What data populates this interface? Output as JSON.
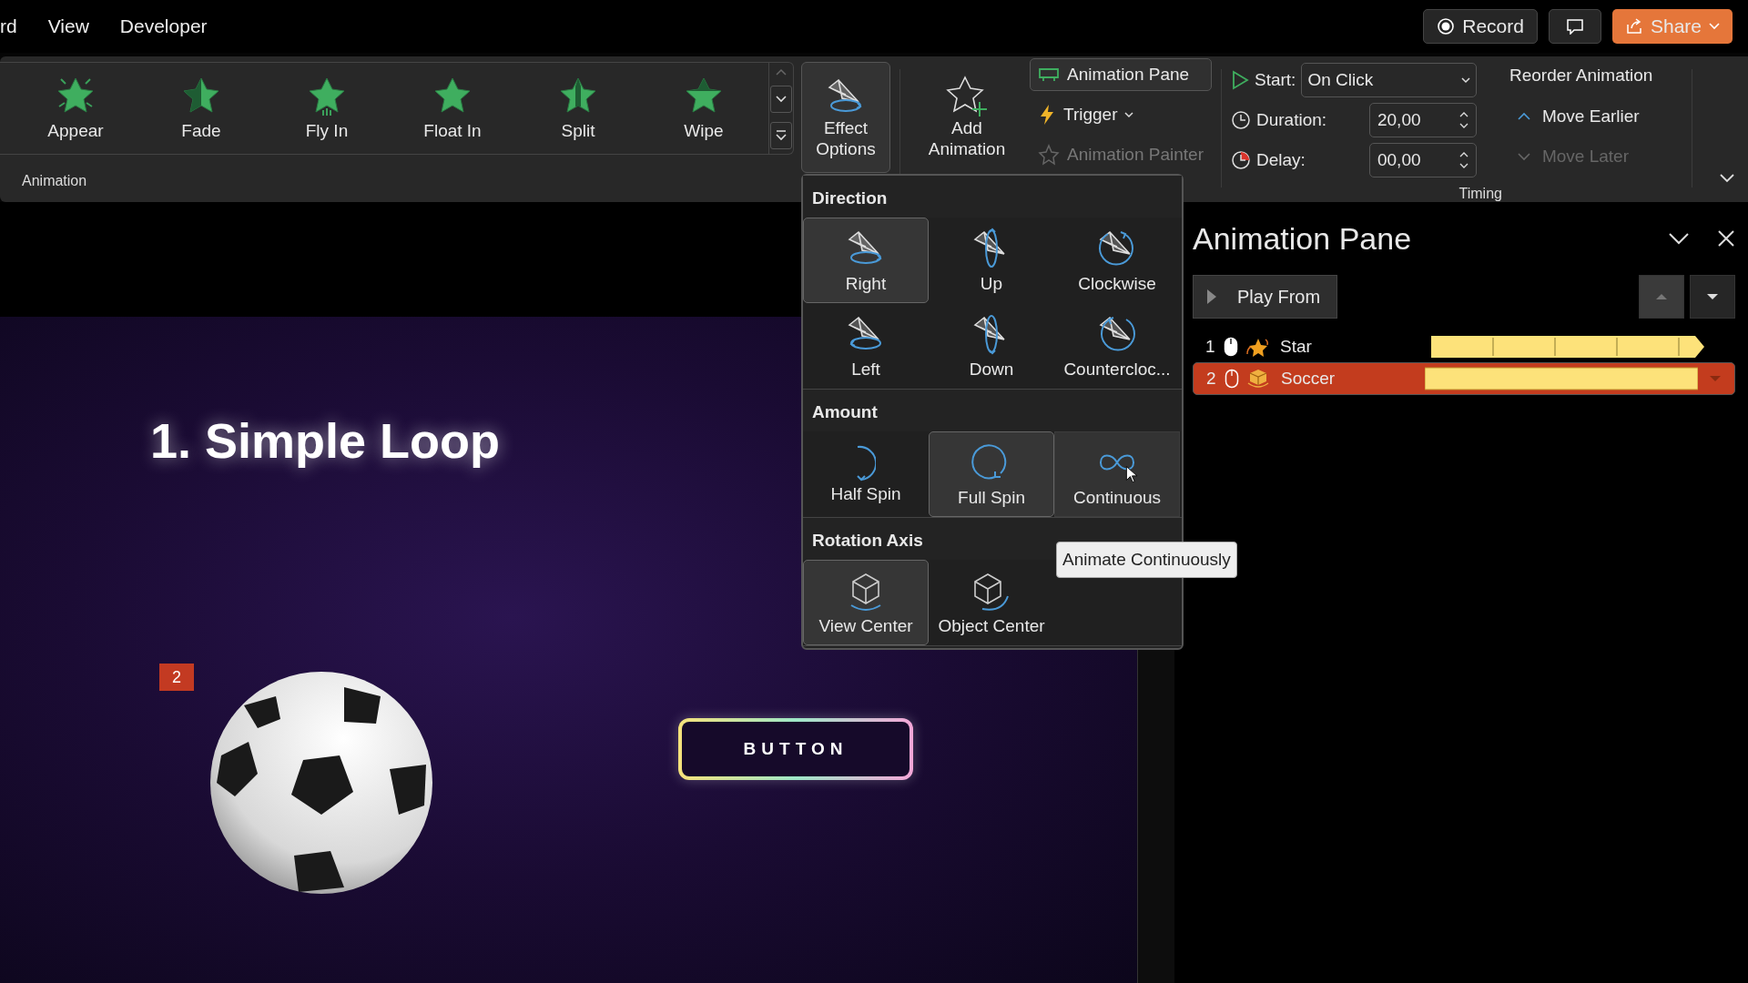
{
  "menu_tabs": [
    {
      "label": "rd"
    },
    {
      "label": "View"
    },
    {
      "label": "Developer"
    }
  ],
  "title_actions": {
    "record": "Record",
    "share": "Share"
  },
  "ribbon": {
    "gallery": {
      "items": [
        {
          "label": "Appear",
          "kind": "burst"
        },
        {
          "label": "Fade",
          "kind": "half"
        },
        {
          "label": "Fly In",
          "kind": "lines"
        },
        {
          "label": "Float In",
          "kind": "plain"
        },
        {
          "label": "Split",
          "kind": "split"
        },
        {
          "label": "Wipe",
          "kind": "wipe"
        }
      ],
      "group_label": "Animation"
    },
    "effect_options": "Effect Options",
    "add_animation": "Add Animation",
    "advanced": [
      {
        "label": "Animation Pane",
        "kind": "pane",
        "disabled": false
      },
      {
        "label": "Trigger",
        "kind": "trigger",
        "disabled": false
      },
      {
        "label": "Animation Painter",
        "kind": "painter",
        "disabled": true
      }
    ],
    "timing": {
      "start": {
        "label": "Start:",
        "value": "On Click"
      },
      "duration": {
        "label": "Duration:",
        "value": "20,00"
      },
      "delay": {
        "label": "Delay:",
        "value": "00,00"
      },
      "group_label": "Timing"
    },
    "reorder": {
      "title": "Reorder Animation",
      "items": [
        {
          "label": "Move Earlier",
          "kind": "up",
          "disabled": false
        },
        {
          "label": "Move Later",
          "kind": "down",
          "disabled": true
        }
      ]
    }
  },
  "effect_menu": {
    "sections": [
      {
        "title": "Direction",
        "options": [
          {
            "label": "Right",
            "kind": "right",
            "selected": true,
            "hovered": false
          },
          {
            "label": "Up",
            "kind": "up",
            "selected": false,
            "hovered": false
          },
          {
            "label": "Clockwise",
            "kind": "cw",
            "selected": false,
            "hovered": false
          },
          {
            "label": "Left",
            "kind": "left",
            "selected": false,
            "hovered": false
          },
          {
            "label": "Down",
            "kind": "down",
            "selected": false,
            "hovered": false
          },
          {
            "label": "Countercloc...",
            "kind": "ccw",
            "selected": false,
            "hovered": false
          }
        ]
      },
      {
        "title": "Amount",
        "options": [
          {
            "label": "Half Spin",
            "kind": "half",
            "selected": false,
            "hovered": false
          },
          {
            "label": "Full Spin",
            "kind": "full",
            "selected": true,
            "hovered": false
          },
          {
            "label": "Continuous",
            "kind": "infinite",
            "selected": false,
            "hovered": true
          }
        ]
      },
      {
        "title": "Rotation Axis",
        "options": [
          {
            "label": "View Center",
            "kind": "view",
            "selected": true,
            "hovered": false
          },
          {
            "label": "Object Center",
            "kind": "object",
            "selected": false,
            "hovered": false
          }
        ]
      }
    ],
    "tooltip": "Animate Continuously"
  },
  "slide": {
    "title": "1. Simple Loop",
    "badge": "2",
    "button_label": "BUTTON"
  },
  "animation_pane": {
    "title": "Animation Pane",
    "play_button": "Play From",
    "items": [
      {
        "number": "1",
        "name": "Star",
        "kind": "star",
        "repeating": true,
        "selected": false
      },
      {
        "number": "2",
        "name": "Soccer",
        "kind": "cube",
        "repeating": false,
        "selected": true
      }
    ]
  }
}
